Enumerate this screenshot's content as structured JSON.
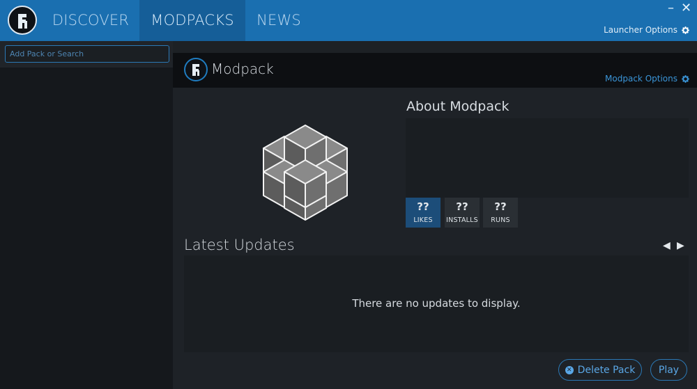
{
  "header": {
    "tabs": [
      {
        "label": "DISCOVER",
        "active": false
      },
      {
        "label": "MODPACKS",
        "active": true
      },
      {
        "label": "NEWS",
        "active": false
      }
    ],
    "minimize": "–",
    "close": "✕",
    "launcher_options": "Launcher Options"
  },
  "sidebar": {
    "search_placeholder": "Add Pack or Search"
  },
  "pack": {
    "title": "Modpack",
    "options_label": "Modpack Options",
    "about_title": "About Modpack",
    "stats": [
      {
        "value": "??",
        "label": "LIKES"
      },
      {
        "value": "??",
        "label": "INSTALLS"
      },
      {
        "value": "??",
        "label": "RUNS"
      }
    ]
  },
  "updates": {
    "title": "Latest Updates",
    "empty_message": "There are no updates to display.",
    "prev": "◀",
    "next": "▶"
  },
  "actions": {
    "delete_label": "Delete Pack",
    "play_label": "Play"
  },
  "colors": {
    "header_bg": "#1a6fb0",
    "active_tab_bg": "#155e98",
    "accent": "#2b79b6",
    "likes_bg": "#1c4d79"
  }
}
